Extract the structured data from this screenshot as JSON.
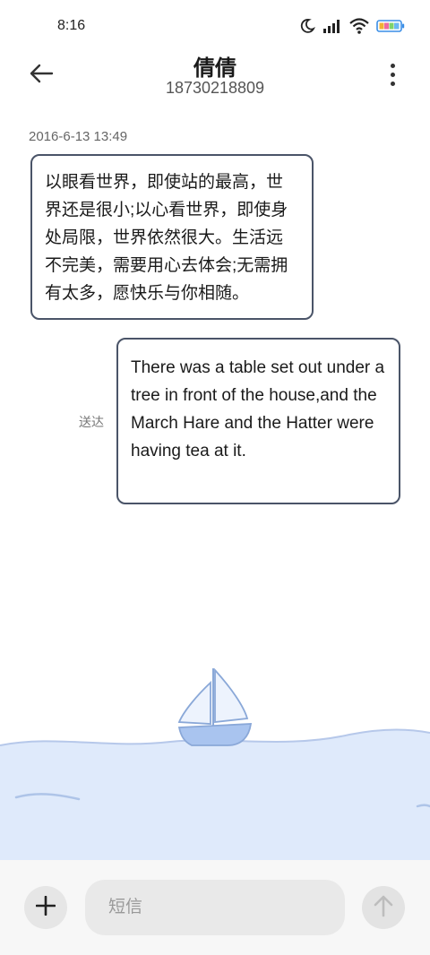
{
  "status_bar": {
    "time": "8:16",
    "icons": [
      "moon-icon",
      "signal-icon",
      "wifi-icon",
      "battery-icon"
    ]
  },
  "header": {
    "contact_name": "倩倩",
    "phone_number": "18730218809",
    "back_icon": "back-arrow-icon",
    "menu_icon": "more-vertical-icon"
  },
  "conversation": {
    "timestamp": "2016-6-13 13:49",
    "messages": [
      {
        "direction": "incoming",
        "text": "以眼看世界，即使站的最高，世界还是很小;以心看世界，即使身处局限，世界依然很大。生活远不完美，需要用心去体会;无需拥有太多，愿快乐与你相随。"
      },
      {
        "direction": "outgoing",
        "text": "There was a table set out under a tree in front of the house,and the March Hare and the Hatter were having tea at it.",
        "status": "送达"
      }
    ]
  },
  "composer": {
    "placeholder": "短信",
    "add_icon": "plus-icon",
    "send_icon": "send-arrow-icon"
  },
  "colors": {
    "bubble_border": "#4a5468",
    "sea_fill": "#dfeafb",
    "sea_line": "#b6c8ea",
    "boat_hull": "#a9c4ef"
  }
}
